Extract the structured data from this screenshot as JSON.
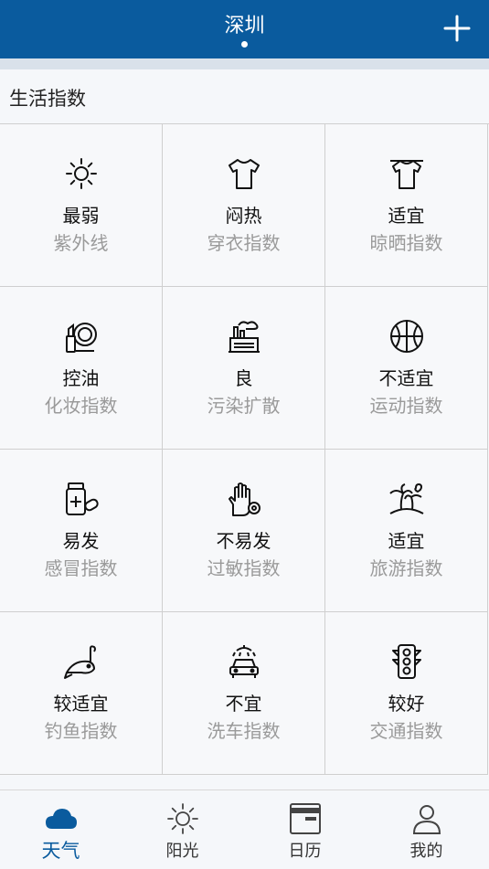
{
  "header": {
    "city": "深圳"
  },
  "section": {
    "title": "生活指数"
  },
  "indices": [
    {
      "icon": "sun-icon",
      "value": "最弱",
      "label": "紫外线"
    },
    {
      "icon": "tshirt-icon",
      "value": "闷热",
      "label": "穿衣指数"
    },
    {
      "icon": "clothes-hanger-icon",
      "value": "适宜",
      "label": "晾晒指数"
    },
    {
      "icon": "makeup-icon",
      "value": "控油",
      "label": "化妆指数"
    },
    {
      "icon": "factory-icon",
      "value": "良",
      "label": "污染扩散"
    },
    {
      "icon": "basketball-icon",
      "value": "不适宜",
      "label": "运动指数"
    },
    {
      "icon": "medicine-icon",
      "value": "易发",
      "label": "感冒指数"
    },
    {
      "icon": "glove-pollen-icon",
      "value": "不易发",
      "label": "过敏指数"
    },
    {
      "icon": "palm-island-icon",
      "value": "适宜",
      "label": "旅游指数"
    },
    {
      "icon": "fish-hook-icon",
      "value": "较适宜",
      "label": "钓鱼指数"
    },
    {
      "icon": "car-wash-icon",
      "value": "不宜",
      "label": "洗车指数"
    },
    {
      "icon": "traffic-light-icon",
      "value": "较好",
      "label": "交通指数"
    }
  ],
  "tabs": [
    {
      "icon": "cloud-icon",
      "label": "天气",
      "active": true
    },
    {
      "icon": "sun-icon",
      "label": "阳光",
      "active": false
    },
    {
      "icon": "calendar-icon",
      "label": "日历",
      "active": false
    },
    {
      "icon": "person-icon",
      "label": "我的",
      "active": false
    }
  ],
  "colors": {
    "accent": "#0a5b9e",
    "muted": "#9a9a9a"
  }
}
